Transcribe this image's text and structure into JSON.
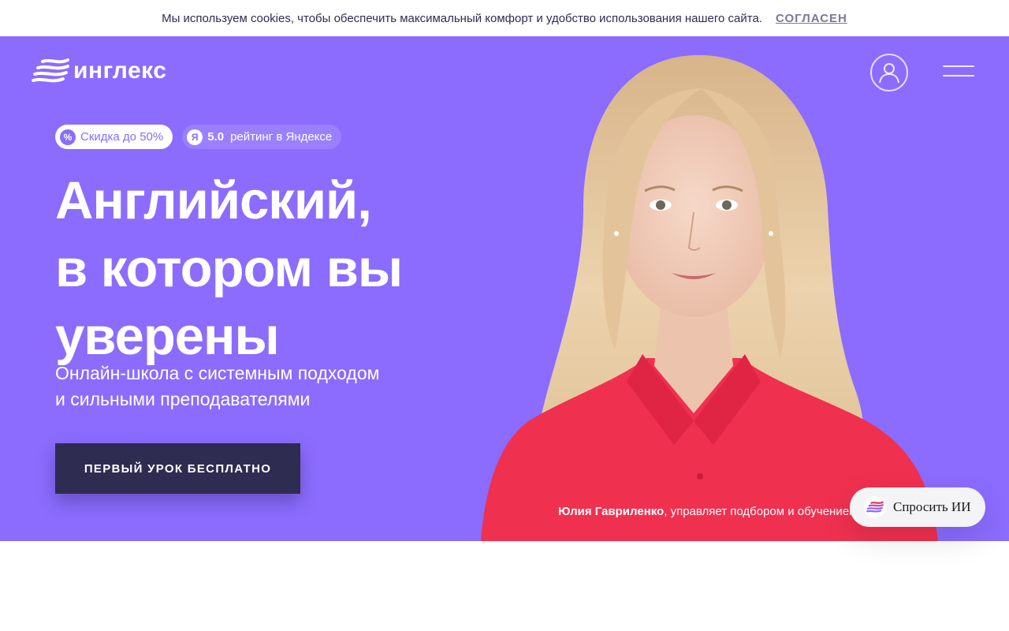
{
  "cookie_bar": {
    "text": "Мы используем cookies, чтобы обеспечить максимальный комфорт и удобство использования нашего сайта.",
    "accept_label": "СОГЛАСЕН"
  },
  "header": {
    "logo_text": "инглекс",
    "profile_icon": "user-circle-icon",
    "menu_icon": "hamburger-menu-icon"
  },
  "badges": {
    "discount": {
      "icon": "%",
      "label": "Скидка до 50%"
    },
    "rating": {
      "icon": "Я",
      "score": "5.0",
      "label": "рейтинг в Яндексе"
    }
  },
  "hero": {
    "headline_lines": [
      "Английский,",
      "в котором вы",
      "уверены"
    ],
    "subtitle_lines": [
      "Онлайн-школа с системным подходом",
      "и сильными преподавателями"
    ],
    "cta_label": "ПЕРВЫЙ УРОК БЕСПЛАТНО",
    "caption_name": "Юлия Гавриленко",
    "caption_rest": ", управляет подбором и обучением"
  },
  "ask_ai": {
    "label": "Спросить ИИ",
    "icon": "englex-logo-icon"
  },
  "colors": {
    "hero_bg": "#8b6cfe",
    "button_dark": "#2f2c52",
    "shirt": "#f0304f",
    "hair": "#e6c9a1"
  }
}
